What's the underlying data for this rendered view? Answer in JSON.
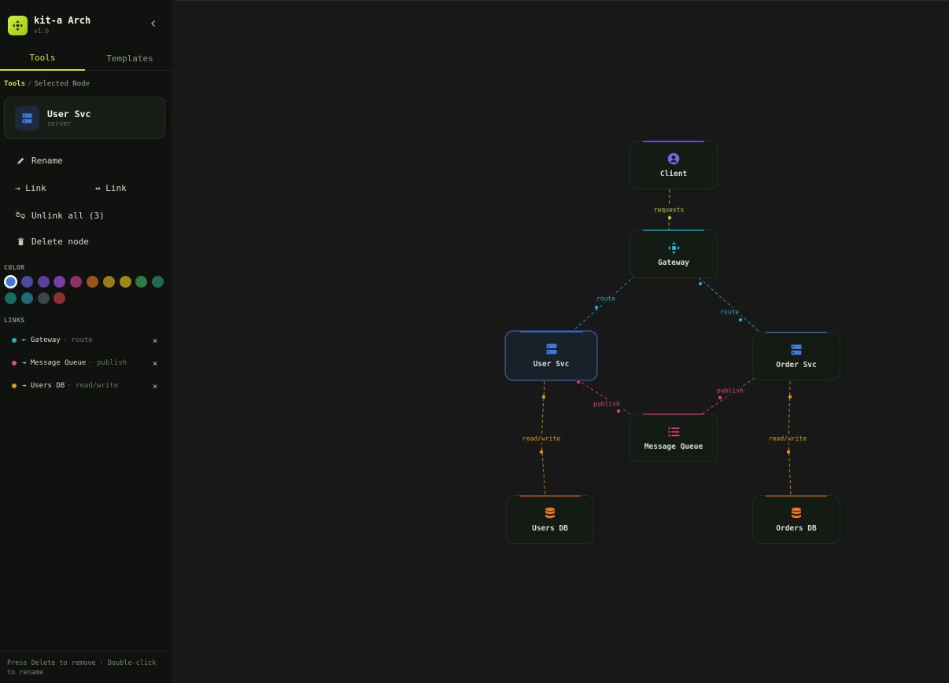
{
  "app": {
    "title": "kit-a Arch",
    "version": "v1.6",
    "accent": "#c9e43a"
  },
  "tabs": [
    {
      "label": "Tools",
      "active": true
    },
    {
      "label": "Templates",
      "active": false
    }
  ],
  "breadcrumb": {
    "root": "Tools",
    "separator": "/",
    "current": "Selected Node"
  },
  "selected_node": {
    "name": "User Svc",
    "type": "server",
    "icon": "server-icon"
  },
  "actions": {
    "rename": "Rename",
    "link_out": "→ Link",
    "link_both": "↔ Link",
    "unlink_all": "Unlink all (3)",
    "delete": "Delete node"
  },
  "color_section": {
    "heading": "COLOR",
    "swatches": [
      "#3f7bd9",
      "#4a4a9e",
      "#5b3f9b",
      "#7a3ea8",
      "#8e3262",
      "#9a5318",
      "#a07a16",
      "#9b8a17",
      "#2c7d43",
      "#1f6b51",
      "#1b6a61",
      "#1f6b7c",
      "#3e4448",
      "#8f3030"
    ],
    "selected_index": 0
  },
  "links_section": {
    "heading": "LINKS",
    "items": [
      {
        "target": "← Gateway",
        "kind": "· route",
        "color": "#22b3c6"
      },
      {
        "target": "→ Message Queue",
        "kind": "· publish",
        "color": "#e2488f"
      },
      {
        "target": "→ Users DB",
        "kind": "· read/write",
        "color": "#e39a1f"
      }
    ],
    "remove_glyph": "×"
  },
  "footer_hint": "Press Delete to remove · Double-click to rename",
  "diagram": {
    "nodes": [
      {
        "id": "client",
        "label": "Client",
        "icon": "user-icon",
        "color": "#6f6be3"
      },
      {
        "id": "gateway",
        "label": "Gateway",
        "icon": "gateway-icon",
        "color": "#1cb2c7"
      },
      {
        "id": "user-svc",
        "label": "User Svc",
        "icon": "server-icon",
        "color": "#3f7bd9",
        "selected": true
      },
      {
        "id": "order-svc",
        "label": "Order Svc",
        "icon": "server-icon",
        "color": "#3f7bd9"
      },
      {
        "id": "message-queue",
        "label": "Message Queue",
        "icon": "queue-icon",
        "color": "#e2488f"
      },
      {
        "id": "users-db",
        "label": "Users DB",
        "icon": "database-icon",
        "color": "#e8781f"
      },
      {
        "id": "orders-db",
        "label": "Orders DB",
        "icon": "database-icon",
        "color": "#e8781f"
      }
    ],
    "edges": [
      {
        "from": "client",
        "to": "gateway",
        "label": "requests",
        "color": "#b5c73a"
      },
      {
        "from": "gateway",
        "to": "user-svc",
        "label": "route",
        "color": "#22a9bd"
      },
      {
        "from": "gateway",
        "to": "order-svc",
        "label": "route",
        "color": "#22a9bd"
      },
      {
        "from": "user-svc",
        "to": "message-queue",
        "label": "publish",
        "color": "#d4418a"
      },
      {
        "from": "order-svc",
        "to": "message-queue",
        "label": "publish",
        "color": "#d4418a"
      },
      {
        "from": "user-svc",
        "to": "users-db",
        "label": "read/write",
        "color": "#d9951d"
      },
      {
        "from": "order-svc",
        "to": "orders-db",
        "label": "read/write",
        "color": "#d9951d"
      }
    ]
  }
}
